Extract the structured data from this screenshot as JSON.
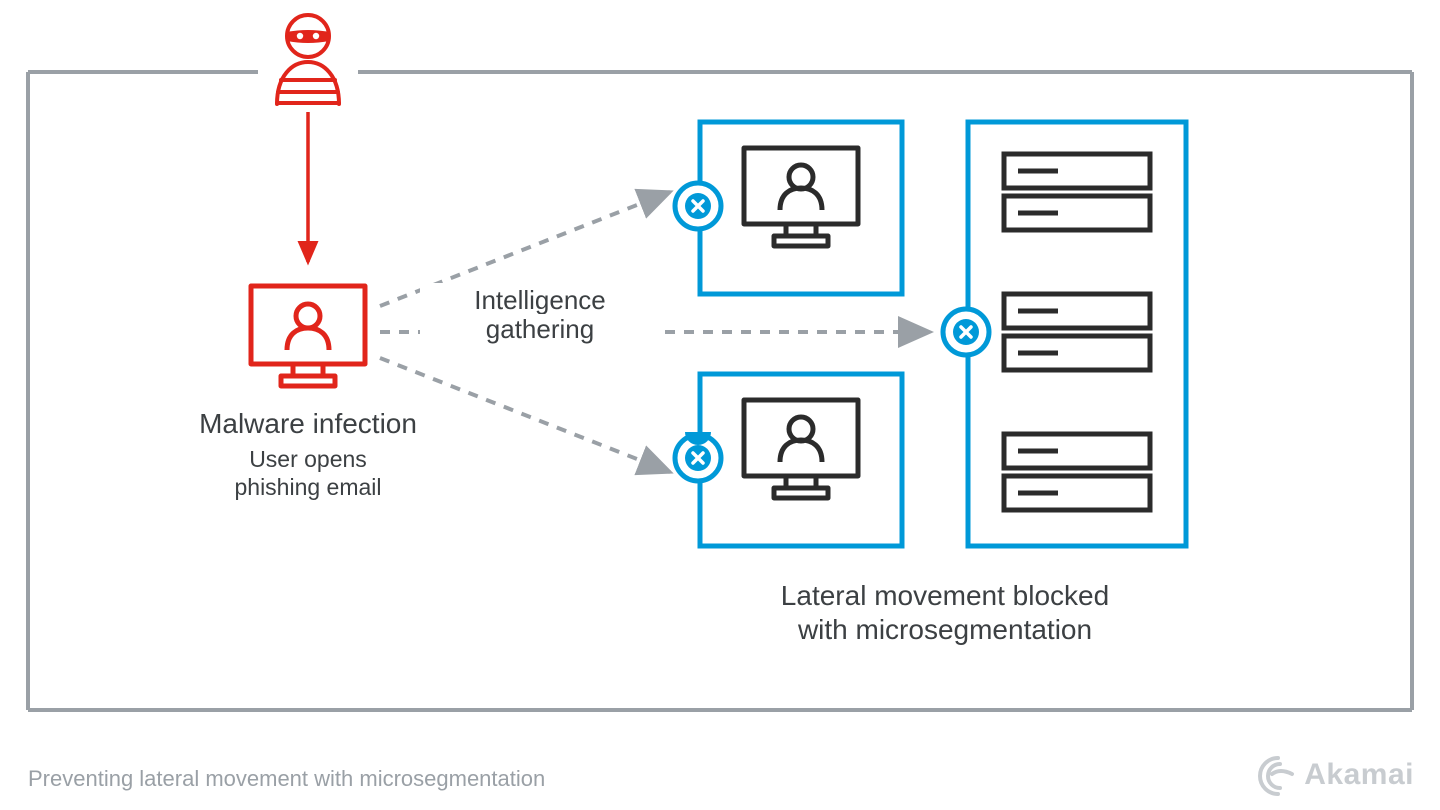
{
  "labels": {
    "malware_title": "Malware infection",
    "malware_sub1": "User opens",
    "malware_sub2": "phishing email",
    "intel1": "Intelligence",
    "intel2": "gathering",
    "lateral1": "Lateral movement blocked",
    "lateral2": "with microsegmentation"
  },
  "caption": "Preventing lateral movement with microsegmentation",
  "brand": "Akamai",
  "colors": {
    "red": "#e1251b",
    "blue": "#0099d8",
    "grey": "#9aa0a6",
    "dark": "#2b2b2b",
    "text": "#3c4043"
  },
  "icons": {
    "attacker": "attacker-icon",
    "infected_workstation": "workstation-icon-red",
    "workstation": "workstation-icon",
    "server_rack": "server-rack-icon",
    "block_badge": "block-x-icon"
  }
}
